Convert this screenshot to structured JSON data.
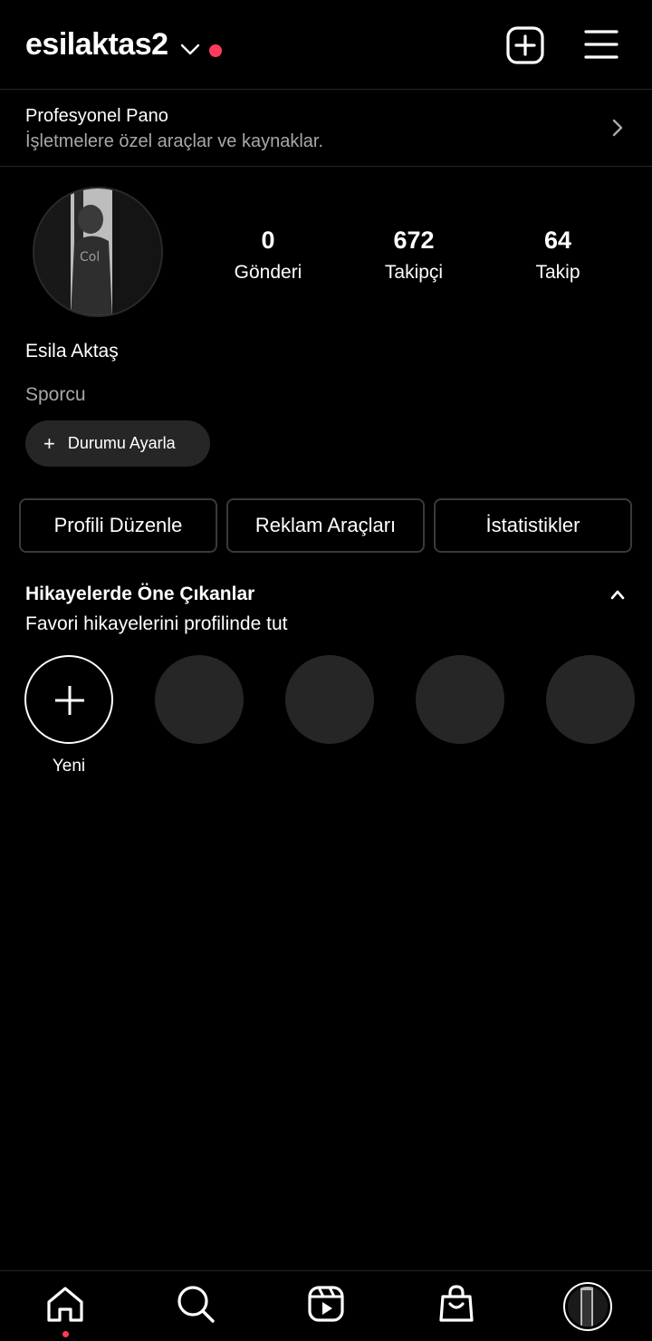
{
  "header": {
    "username": "esilaktas2",
    "notification_color": "#ff3b5c"
  },
  "pro_dashboard": {
    "title": "Profesyonel Pano",
    "subtitle": "İşletmelere özel araçlar ve kaynaklar."
  },
  "profile": {
    "stats": [
      {
        "value": "0",
        "label": "Gönderi"
      },
      {
        "value": "672",
        "label": "Takipçi"
      },
      {
        "value": "64",
        "label": "Takip"
      }
    ],
    "full_name": "Esila Aktaş",
    "category": "Sporcu",
    "status_button": "Durumu Ayarla"
  },
  "actions": {
    "edit_profile": "Profili Düzenle",
    "ad_tools": "Reklam Araçları",
    "insights": "İstatistikler"
  },
  "highlights": {
    "title": "Hikayelerde Öne Çıkanlar",
    "subtitle": "Favori hikayelerini profilinde tut",
    "new_label": "Yeni"
  },
  "bottom_nav": {
    "items": [
      "home-icon",
      "search-icon",
      "reels-icon",
      "shop-icon",
      "profile-avatar"
    ]
  }
}
